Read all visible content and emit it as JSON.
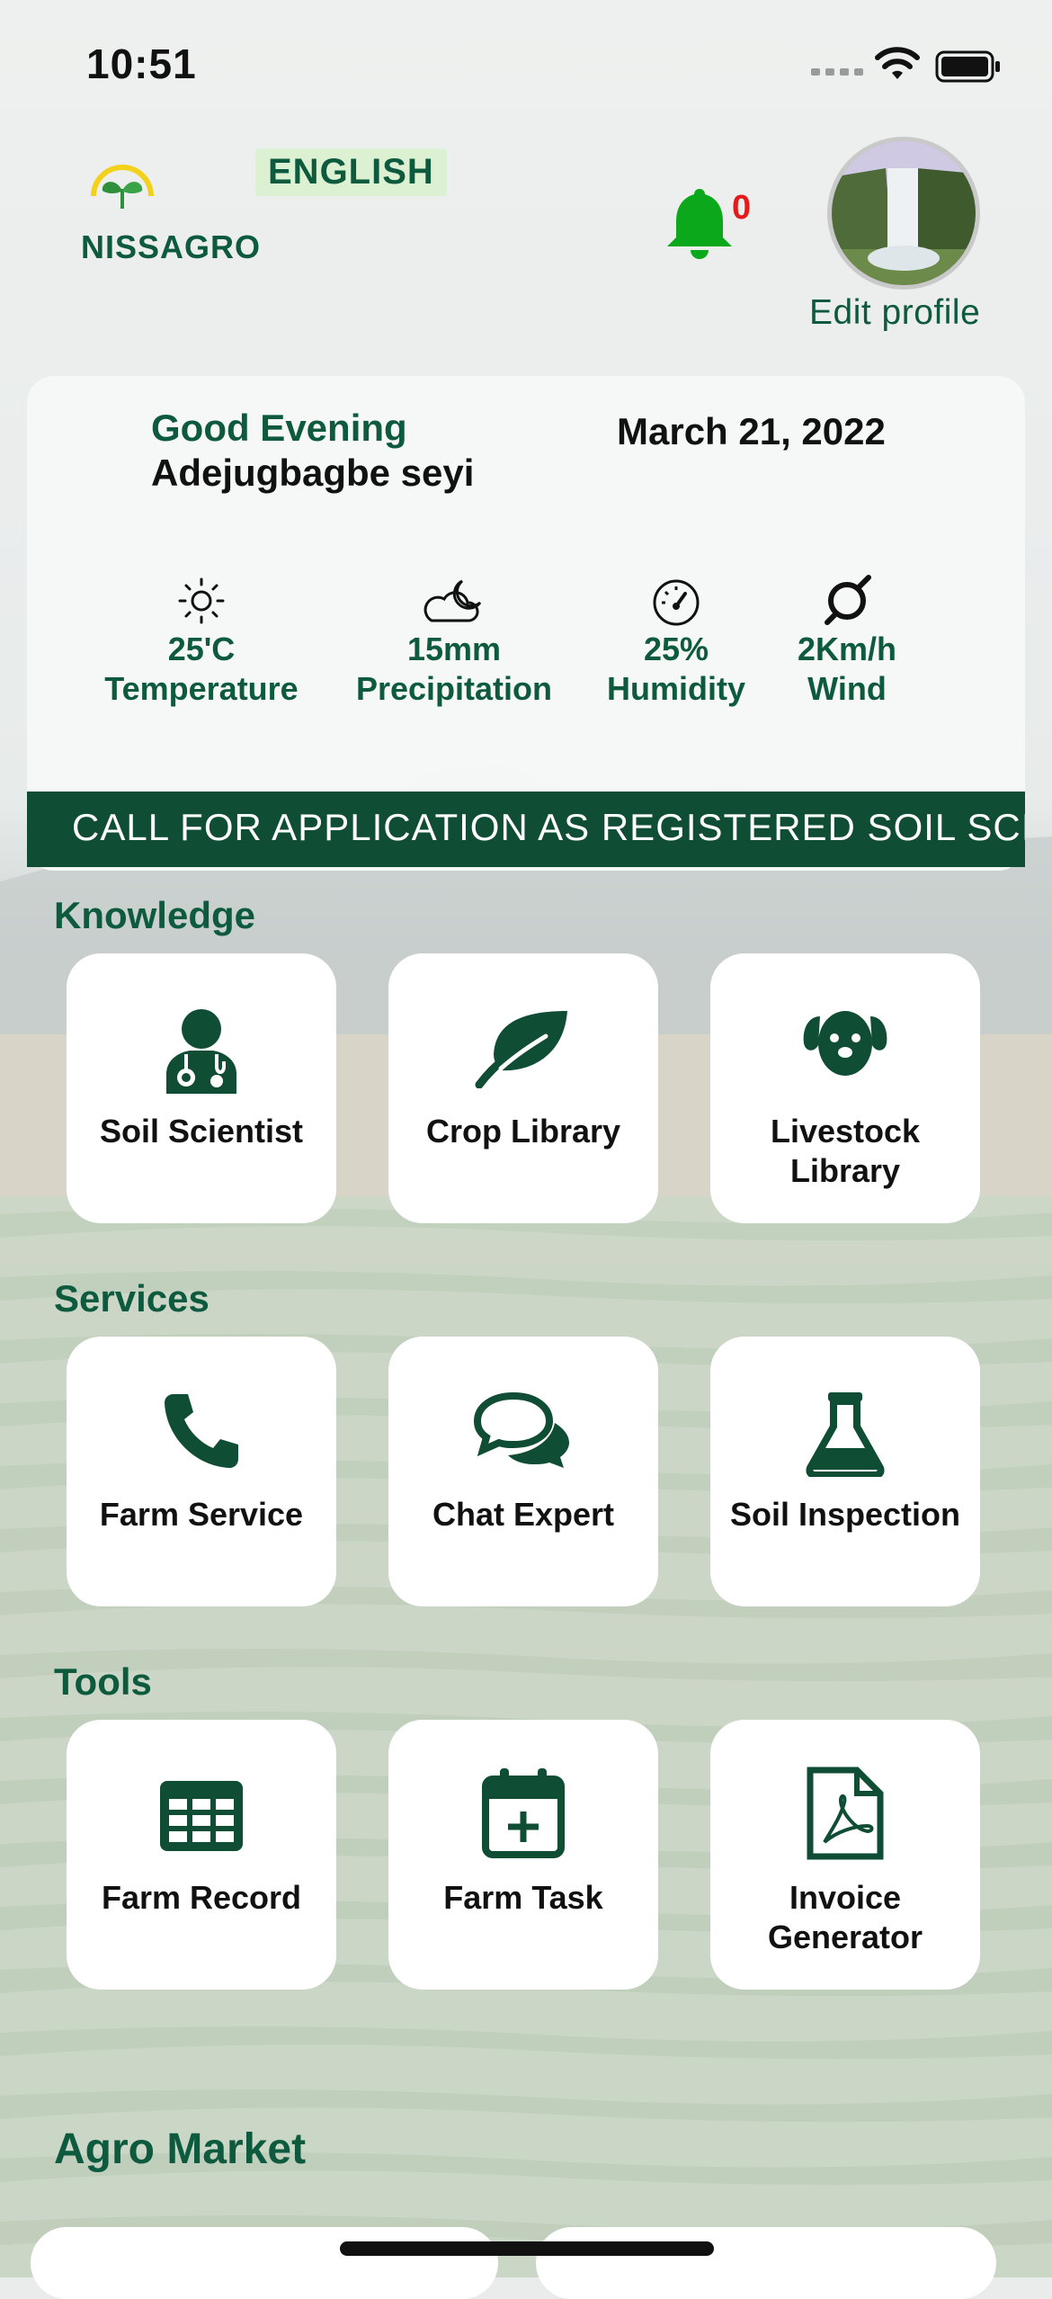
{
  "status_bar": {
    "time": "10:51"
  },
  "header": {
    "brand": "NISSAGRO",
    "language": "ENGLISH",
    "notification_count": "0",
    "edit_profile": "Edit profile"
  },
  "greeting_card": {
    "greeting": "Good Evening",
    "user_name": "Adejugbagbe seyi",
    "date": "March 21, 2022",
    "weather": [
      {
        "value": "25'C",
        "label": "Temperature",
        "icon": "sun-icon"
      },
      {
        "value": "15mm",
        "label": "Precipitation",
        "icon": "cloud-moon-icon"
      },
      {
        "value": "25%",
        "label": "Humidity",
        "icon": "gauge-icon"
      },
      {
        "value": "2Km/h",
        "label": "Wind",
        "icon": "wind-icon"
      }
    ]
  },
  "banner": {
    "text": "CALL FOR APPLICATION AS REGISTERED SOIL SCIENTIST"
  },
  "sections": {
    "knowledge": {
      "title": "Knowledge",
      "items": [
        {
          "label": "Soil Scientist",
          "icon": "doctor-icon"
        },
        {
          "label": "Crop Library",
          "icon": "leaf-icon"
        },
        {
          "label": "Livestock Library",
          "icon": "dog-icon"
        }
      ]
    },
    "services": {
      "title": "Services",
      "items": [
        {
          "label": "Farm Service",
          "icon": "phone-icon"
        },
        {
          "label": "Chat Expert",
          "icon": "chat-icon"
        },
        {
          "label": "Soil Inspection",
          "icon": "flask-icon"
        }
      ]
    },
    "tools": {
      "title": "Tools",
      "items": [
        {
          "label": "Farm Record",
          "icon": "table-icon"
        },
        {
          "label": "Farm Task",
          "icon": "calendar-plus-icon"
        },
        {
          "label": "Invoice Generator",
          "icon": "pdf-file-icon"
        }
      ]
    },
    "agro_market": {
      "title": "Agro Market"
    }
  },
  "colors": {
    "brand": "#0d5a3e",
    "banner": "#0f4d35",
    "badge": "#e21b1b"
  }
}
